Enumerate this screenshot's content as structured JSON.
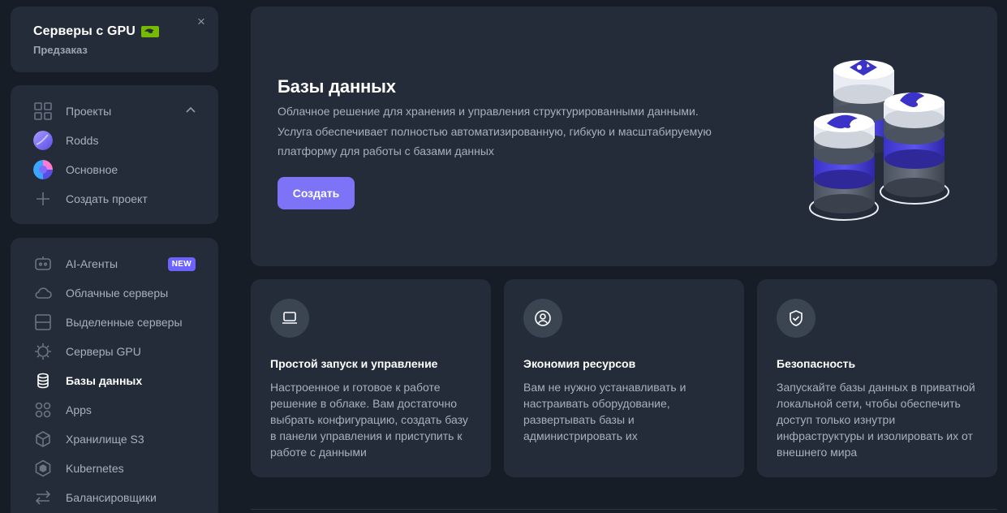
{
  "promo": {
    "title": "Серверы с GPU",
    "subtitle": "Предзаказ",
    "close": "×"
  },
  "projects": {
    "items": [
      {
        "label": "Проекты",
        "icon": "grid-icon"
      },
      {
        "label": "Rodds",
        "icon": "avatar-purple"
      },
      {
        "label": "Основное",
        "icon": "avatar-multicolor"
      },
      {
        "label": "Создать проект",
        "icon": "plus-icon"
      }
    ]
  },
  "services": {
    "badge_new": "NEW",
    "items": [
      {
        "label": "AI-Агенты",
        "icon": "robot-icon"
      },
      {
        "label": "Облачные серверы",
        "icon": "cloud-icon"
      },
      {
        "label": "Выделенные серверы",
        "icon": "server-icon"
      },
      {
        "label": "Серверы GPU",
        "icon": "chip-icon"
      },
      {
        "label": "Базы данных",
        "icon": "database-icon",
        "active": true
      },
      {
        "label": "Apps",
        "icon": "apps-icon"
      },
      {
        "label": "Хранилище S3",
        "icon": "cube-icon"
      },
      {
        "label": "Kubernetes",
        "icon": "kubernetes-icon"
      },
      {
        "label": "Балансировщики",
        "icon": "arrows-icon"
      }
    ]
  },
  "hero": {
    "title": "Базы данных",
    "description": "Облачное решение для хранения и управления структурированными данными. Услуга обеспечивает полностью автоматизированную, гибкую и масштабируемую платформу для работы с базами данных",
    "button": "Создать"
  },
  "features": [
    {
      "icon": "laptop-icon",
      "title": "Простой запуск и управление",
      "description": "Настроенное и готовое к работе решение в облаке. Вам достаточно выбрать конфигурацию, создать базу в панели управления и приступить к работе с данными"
    },
    {
      "icon": "user-circle-icon",
      "title": "Экономия ресурсов",
      "description": "Вам не нужно устанавливать и настраивать оборудование, развертывать базы и администрировать их"
    },
    {
      "icon": "shield-check-icon",
      "title": "Безопасность",
      "description": "Запускайте базы данных в приватной локальной сети, чтобы обеспечить доступ только изнутри инфраструктуры и изолировать их от внешнего мира"
    }
  ],
  "colors": {
    "background": "#161d26",
    "card": "#232c38",
    "accent": "#7c73f6",
    "badge": "#6c63ff",
    "text_muted": "#a8b0bc"
  }
}
